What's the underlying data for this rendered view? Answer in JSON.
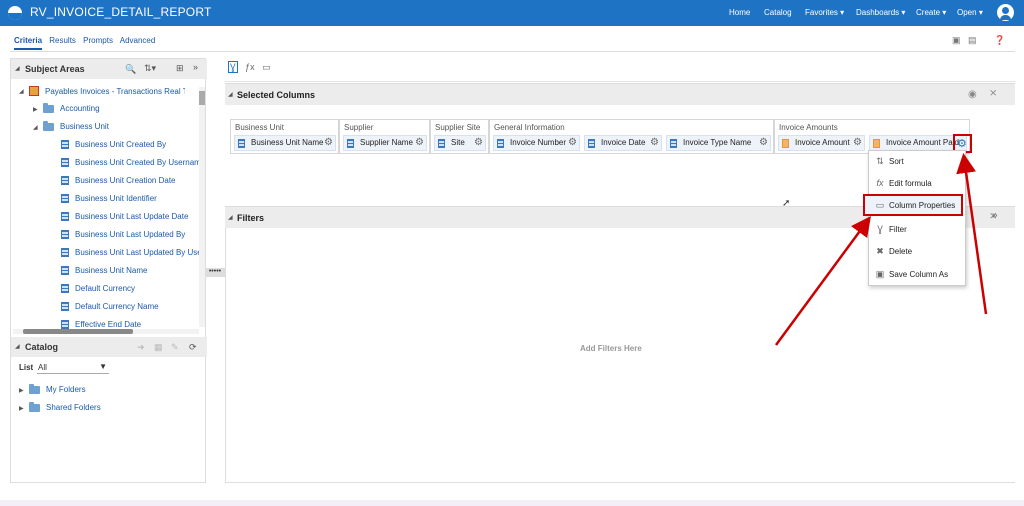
{
  "app": {
    "title": "RV_INVOICE_DETAIL_REPORT",
    "nav": [
      {
        "label": "Home",
        "caret": false
      },
      {
        "label": "Catalog",
        "caret": false
      },
      {
        "label": "Favorites",
        "caret": true
      },
      {
        "label": "Dashboards",
        "caret": true
      },
      {
        "label": "Create",
        "caret": true
      },
      {
        "label": "Open",
        "caret": true
      }
    ]
  },
  "tabs": [
    "Criteria",
    "Results",
    "Prompts",
    "Advanced"
  ],
  "subject_areas": {
    "header": "Subject Areas",
    "root": "Payables Invoices - Transactions Real Time",
    "folders": [
      "Accounting",
      "Business Unit"
    ],
    "columns": [
      "Business Unit Created By",
      "Business Unit Created By Username",
      "Business Unit Creation Date",
      "Business Unit Identifier",
      "Business Unit Last Update Date",
      "Business Unit Last Updated By",
      "Business Unit Last Updated By User",
      "Business Unit Name",
      "Default Currency",
      "Default Currency Name",
      "Effective End Date"
    ]
  },
  "catalog": {
    "header": "Catalog",
    "list_label": "List",
    "list_value": "All",
    "folders": [
      "My Folders",
      "Shared Folders"
    ]
  },
  "selected_columns": {
    "header": "Selected Columns",
    "groups": [
      {
        "name": "Business Unit",
        "columns": [
          {
            "label": "Business Unit Name",
            "type": "attribute"
          }
        ]
      },
      {
        "name": "Supplier",
        "columns": [
          {
            "label": "Supplier Name",
            "type": "attribute"
          }
        ]
      },
      {
        "name": "Supplier Site",
        "columns": [
          {
            "label": "Site",
            "type": "attribute"
          }
        ]
      },
      {
        "name": "General Information",
        "columns": [
          {
            "label": "Invoice Number",
            "type": "attribute"
          },
          {
            "label": "Invoice Date",
            "type": "attribute"
          },
          {
            "label": "Invoice Type Name",
            "type": "attribute"
          }
        ]
      },
      {
        "name": "Invoice Amounts",
        "columns": [
          {
            "label": "Invoice Amount",
            "type": "measure"
          },
          {
            "label": "Invoice Amount Paid",
            "type": "measure"
          }
        ]
      }
    ]
  },
  "filters": {
    "header": "Filters",
    "empty_text": "Add Filters Here"
  },
  "column_menu": {
    "items": [
      {
        "label": "Sort",
        "icon": "sort-icon"
      },
      {
        "label": "Edit formula",
        "icon": "formula-icon"
      },
      {
        "label": "Column Properties",
        "icon": "column-properties-icon",
        "highlighted": true
      },
      {
        "label": "Filter",
        "icon": "filter-icon"
      },
      {
        "label": "Delete",
        "icon": "delete-icon"
      },
      {
        "label": "Save Column As",
        "icon": "save-icon"
      }
    ]
  },
  "colors": {
    "topbar": "#1f73c4",
    "accent": "#1a5aa8",
    "annotation_red": "#c00000"
  }
}
